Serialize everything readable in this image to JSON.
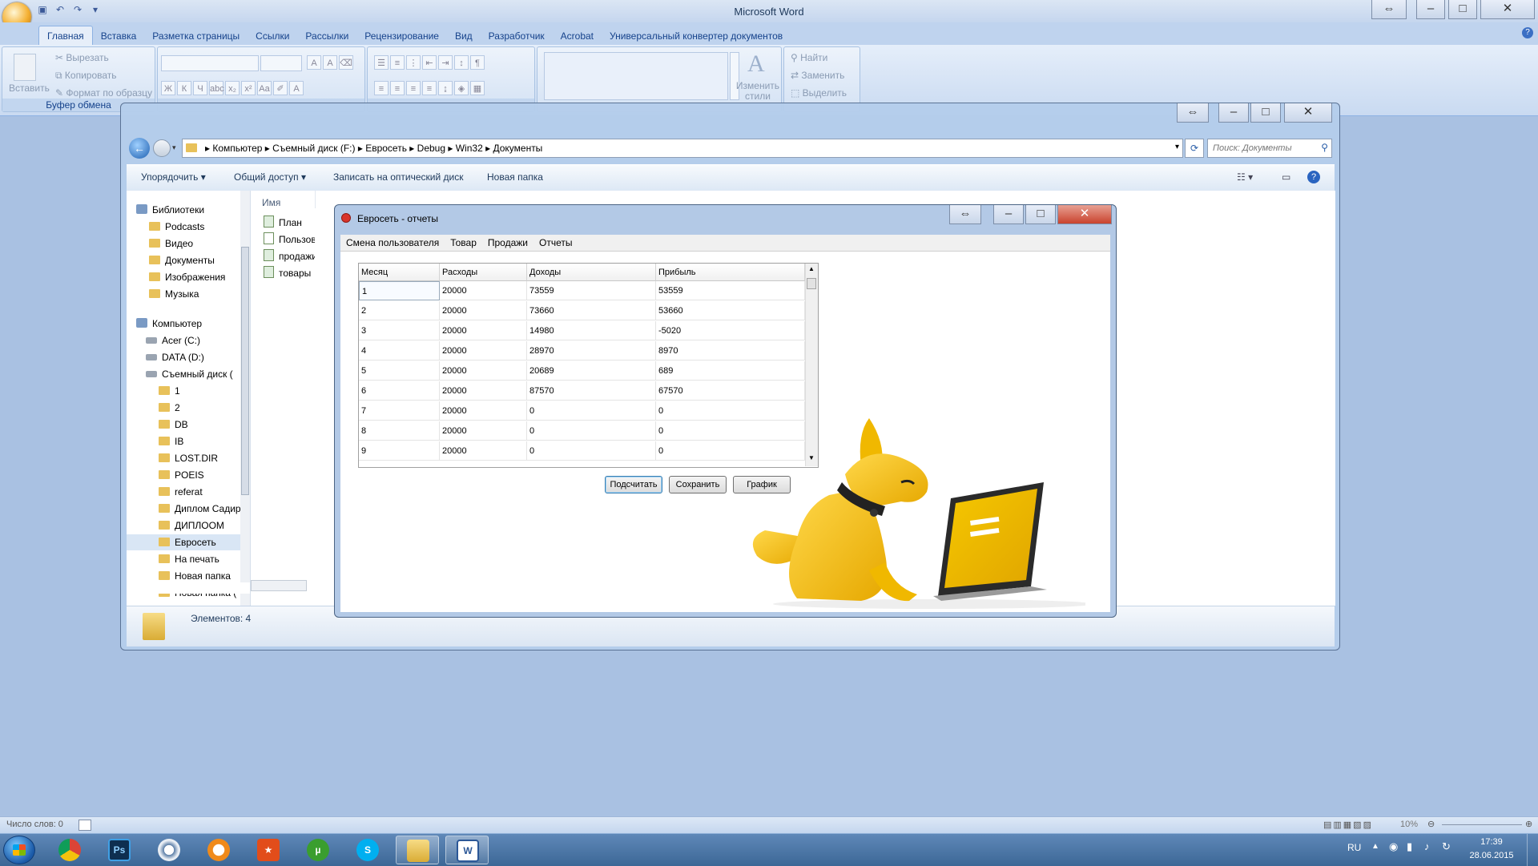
{
  "word": {
    "title": "Microsoft Word",
    "tabs": [
      "Главная",
      "Вставка",
      "Разметка страницы",
      "Ссылки",
      "Рассылки",
      "Рецензирование",
      "Вид",
      "Разработчик",
      "Acrobat",
      "Универсальный конвертер документов"
    ],
    "clipboard": {
      "paste": "Вставить",
      "cut": "Вырезать",
      "copy": "Копировать",
      "format": "Формат по образцу",
      "group": "Буфер обмена"
    },
    "styles": {
      "change": "Изменить стили"
    },
    "editing": {
      "find": "Найти",
      "replace": "Заменить",
      "select": "Выделить"
    },
    "font_buttons": {
      "bold": "Ж",
      "italic": "К",
      "underline": "Ч",
      "strike": "abc",
      "sub": "x₂",
      "sup": "x²",
      "case": "Aa",
      "grow": "A",
      "shrink": "A"
    },
    "status": {
      "words": "Число слов: 0",
      "zoom": "10%"
    }
  },
  "explorer": {
    "breadcrumb": [
      "Компьютер",
      "Съемный диск (F:)",
      "Евросеть",
      "Debug",
      "Win32",
      "Документы"
    ],
    "search_placeholder": "Поиск: Документы",
    "toolbar": {
      "organize": "Упорядочить",
      "share": "Общий доступ",
      "burn": "Записать на оптический диск",
      "new_folder": "Новая папка"
    },
    "nav": [
      {
        "label": "Библиотеки",
        "kind": "header"
      },
      {
        "label": "Podcasts",
        "kind": "lib"
      },
      {
        "label": "Видео",
        "kind": "lib"
      },
      {
        "label": "Документы",
        "kind": "lib"
      },
      {
        "label": "Изображения",
        "kind": "lib"
      },
      {
        "label": "Музыка",
        "kind": "lib"
      },
      {
        "label": "Компьютер",
        "kind": "header"
      },
      {
        "label": "Acer (C:)",
        "kind": "drive"
      },
      {
        "label": "DATA (D:)",
        "kind": "drive"
      },
      {
        "label": "Съемный диск (",
        "kind": "drive"
      },
      {
        "label": "1",
        "kind": "folder"
      },
      {
        "label": "2",
        "kind": "folder"
      },
      {
        "label": "DB",
        "kind": "folder"
      },
      {
        "label": "IB",
        "kind": "folder"
      },
      {
        "label": "LOST.DIR",
        "kind": "folder"
      },
      {
        "label": "POEIS",
        "kind": "folder"
      },
      {
        "label": "referat",
        "kind": "folder"
      },
      {
        "label": "Диплом Садир",
        "kind": "folder"
      },
      {
        "label": "ДИПЛООМ",
        "kind": "folder"
      },
      {
        "label": "Евросеть",
        "kind": "folder"
      },
      {
        "label": "На печать",
        "kind": "folder"
      },
      {
        "label": "Новая папка",
        "kind": "folder"
      },
      {
        "label": "Новая папка (",
        "kind": "folder"
      }
    ],
    "column_name": "Имя",
    "files": [
      "План",
      "Пользоват",
      "продажи",
      "товары"
    ],
    "details": "Элементов: 4"
  },
  "dialog": {
    "title": "Евросеть - отчеты",
    "menu": [
      "Смена пользователя",
      "Товар",
      "Продажи",
      "Отчеты"
    ],
    "columns": [
      "Месяц",
      "Расходы",
      "Доходы",
      "Прибыль"
    ],
    "rows": [
      [
        "1",
        "20000",
        "73559",
        "53559"
      ],
      [
        "2",
        "20000",
        "73660",
        "53660"
      ],
      [
        "3",
        "20000",
        "14980",
        "-5020"
      ],
      [
        "4",
        "20000",
        "28970",
        "8970"
      ],
      [
        "5",
        "20000",
        "20689",
        "689"
      ],
      [
        "6",
        "20000",
        "87570",
        "67570"
      ],
      [
        "7",
        "20000",
        "0",
        "0"
      ],
      [
        "8",
        "20000",
        "0",
        "0"
      ],
      [
        "9",
        "20000",
        "0",
        "0"
      ]
    ],
    "buttons": {
      "calc": "Подсчитать",
      "save": "Сохранить",
      "chart": "График"
    }
  },
  "taskbar": {
    "lang": "RU",
    "time": "17:39",
    "date": "28.06.2015"
  },
  "colors": {
    "taskbar": "#3c6796",
    "desktop": "#a9c1e2",
    "euroset_yellow": "#f5c000"
  }
}
